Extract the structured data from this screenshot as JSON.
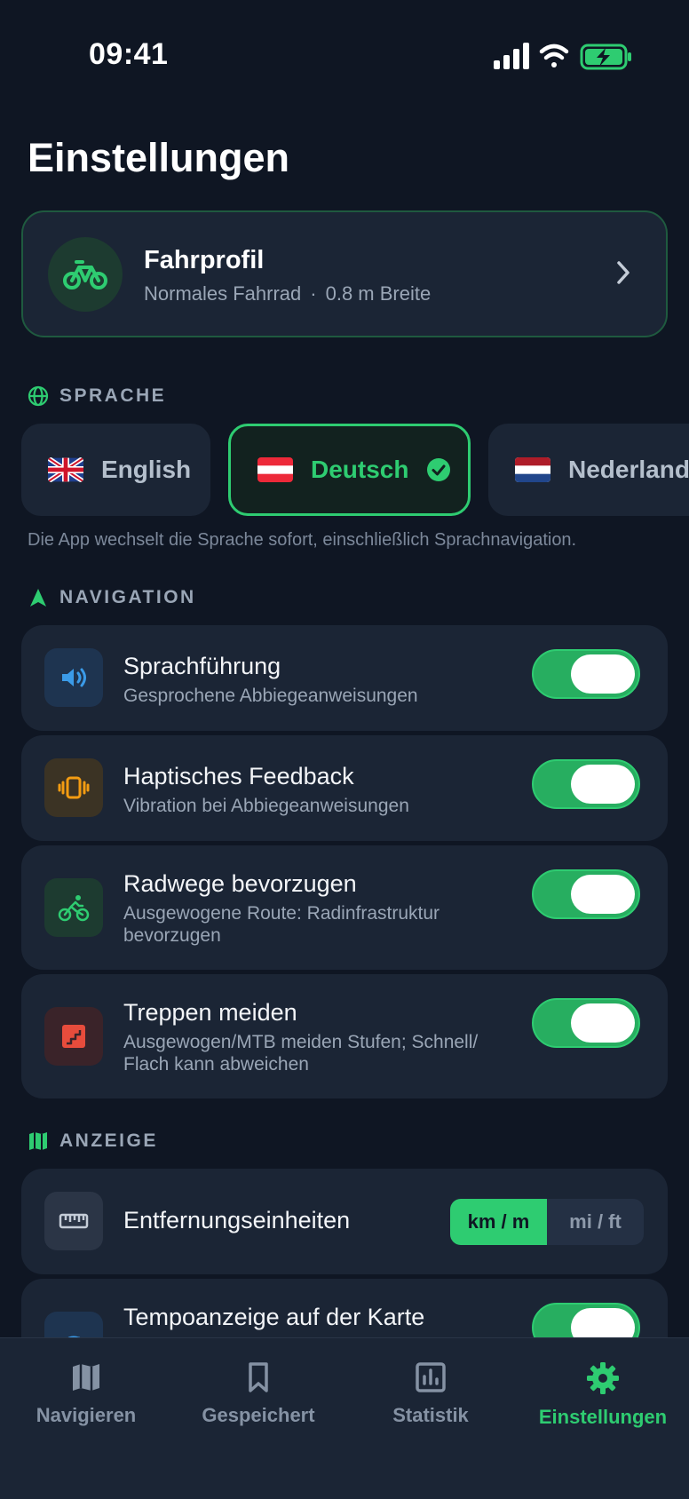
{
  "status": {
    "time": "09:41"
  },
  "page": {
    "title": "Einstellungen"
  },
  "profile": {
    "title": "Fahrprofil",
    "type": "Normales Fahrrad",
    "separator": "·",
    "width": "0.8 m Breite"
  },
  "language": {
    "header": "SPRACHE",
    "options": [
      {
        "label": "English"
      },
      {
        "label": "Deutsch",
        "selected": true
      },
      {
        "label": "Nederlands"
      }
    ],
    "note": "Die App wechselt die Sprache sofort, einschließlich Sprachnavigation."
  },
  "navigation": {
    "header": "NAVIGATION",
    "items": [
      {
        "title": "Sprachführung",
        "subtitle": "Gesprochene Abbiegeanweisungen",
        "enabled": true
      },
      {
        "title": "Haptisches Feedback",
        "subtitle": "Vibration bei Abbiegeanweisungen",
        "enabled": true
      },
      {
        "title": "Radwege bevorzugen",
        "subtitle": "Ausgewogene Route: Radinfrastruktur bevorzugen",
        "enabled": true
      },
      {
        "title": "Treppen meiden",
        "subtitle": "Ausgewogen/MTB meiden Stufen; Schnell/ Flach kann abweichen",
        "enabled": true
      }
    ]
  },
  "display": {
    "header": "ANZEIGE",
    "units": {
      "title": "Entfernungseinheiten",
      "options": [
        "km / m",
        "mi / ft"
      ],
      "selected": "km / m"
    },
    "speed": {
      "title": "Tempoanzeige auf der Karte",
      "enabled": true
    }
  },
  "tabs": [
    {
      "label": "Navigieren"
    },
    {
      "label": "Gespeichert"
    },
    {
      "label": "Statistik"
    },
    {
      "label": "Einstellungen",
      "active": true
    }
  ],
  "colors": {
    "accent": "#2ecc71",
    "background": "#0f1623",
    "card": "#1b2535"
  }
}
